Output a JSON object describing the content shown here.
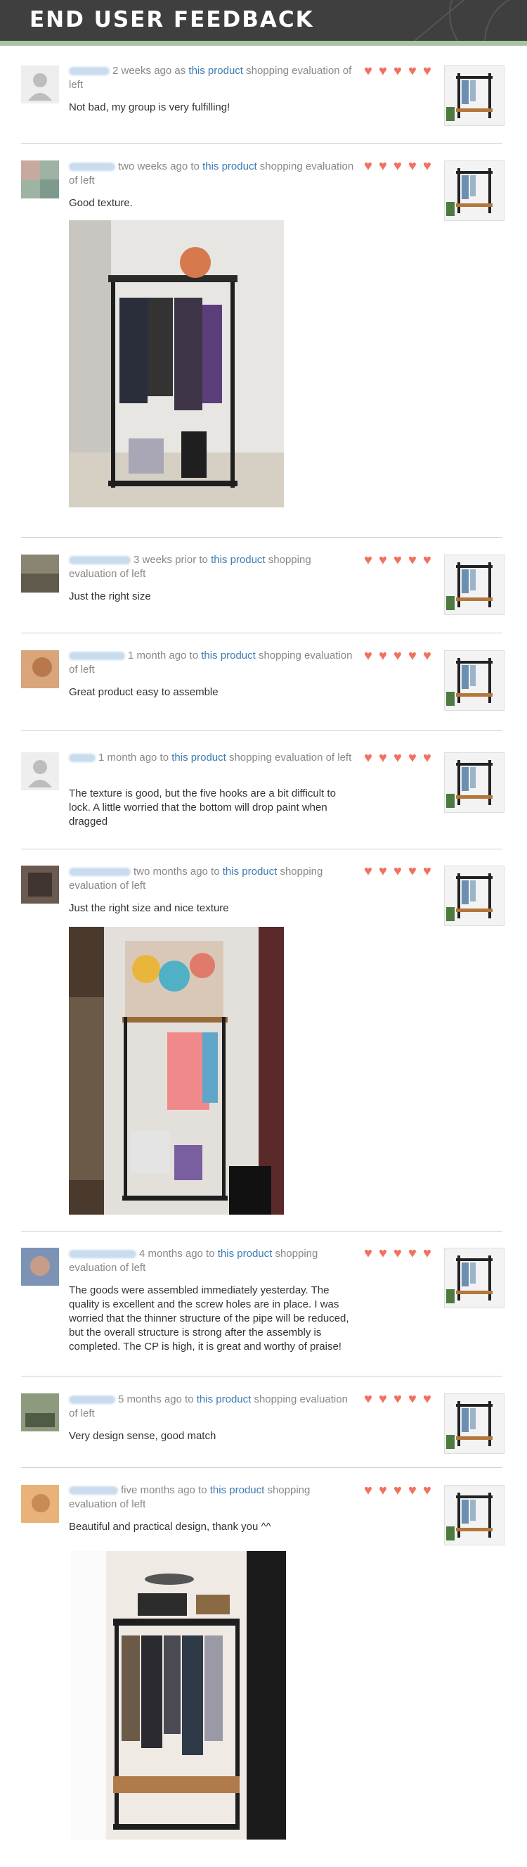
{
  "header": {
    "title": "END USER FEEDBACK"
  },
  "colors": {
    "header_bg": "#3f3f3f",
    "accent_line": "#a9c4a4",
    "heart": "#f2705e",
    "link": "#3d7bb3"
  },
  "reviews": [
    {
      "time_prefix": "2 weeks ago as",
      "link": "this product",
      "suffix": "shopping evaluation of left",
      "text": "Not bad, my group is very fulfilling!",
      "rating": 5,
      "avatar": "default-avatar-icon"
    },
    {
      "time_prefix": "two weeks ago to",
      "link": "this product",
      "suffix": "shopping evaluation of left",
      "text": "Good texture.",
      "rating": 5,
      "avatar": "user-photo"
    },
    {
      "time_prefix": "3 weeks prior to",
      "link": "this product",
      "suffix": "shopping evaluation of left",
      "text": "Just the right size",
      "rating": 5,
      "avatar": "user-photo"
    },
    {
      "time_prefix": "1 month ago to",
      "link": "this product",
      "suffix": "shopping evaluation of left",
      "text": "Great product easy to assemble",
      "rating": 5,
      "avatar": "user-photo"
    },
    {
      "time_prefix": "1 month ago to",
      "link": "this product",
      "suffix": "shopping evaluation of left",
      "text": "The texture is good, but the five hooks are a bit difficult to lock. A little worried that the bottom will drop paint when dragged",
      "rating": 5,
      "avatar": "default-avatar-icon"
    },
    {
      "time_prefix": "two months ago to",
      "link": "this product",
      "suffix": "shopping evaluation of left",
      "text": "Just the right size and nice texture",
      "rating": 5,
      "avatar": "user-photo"
    },
    {
      "time_prefix": "4 months ago to",
      "link": "this product",
      "suffix": "shopping evaluation of left",
      "text": "The goods were assembled immediately yesterday. The quality is excellent and the screw holes are in place. I was worried that the thinner structure of the pipe will be reduced, but the overall structure is strong after the assembly is completed. The CP is high, it is great and worthy of praise!",
      "rating": 5,
      "avatar": "user-photo"
    },
    {
      "time_prefix": "5 months ago to",
      "link": "this product",
      "suffix": "shopping evaluation of left",
      "text": "Very design sense, good match",
      "rating": 5,
      "avatar": "user-photo"
    },
    {
      "time_prefix": "five months ago to",
      "link": "this product",
      "suffix": "shopping evaluation of left",
      "text": "Beautiful and practical design, thank you ^^",
      "rating": 5,
      "avatar": "user-photo"
    }
  ]
}
